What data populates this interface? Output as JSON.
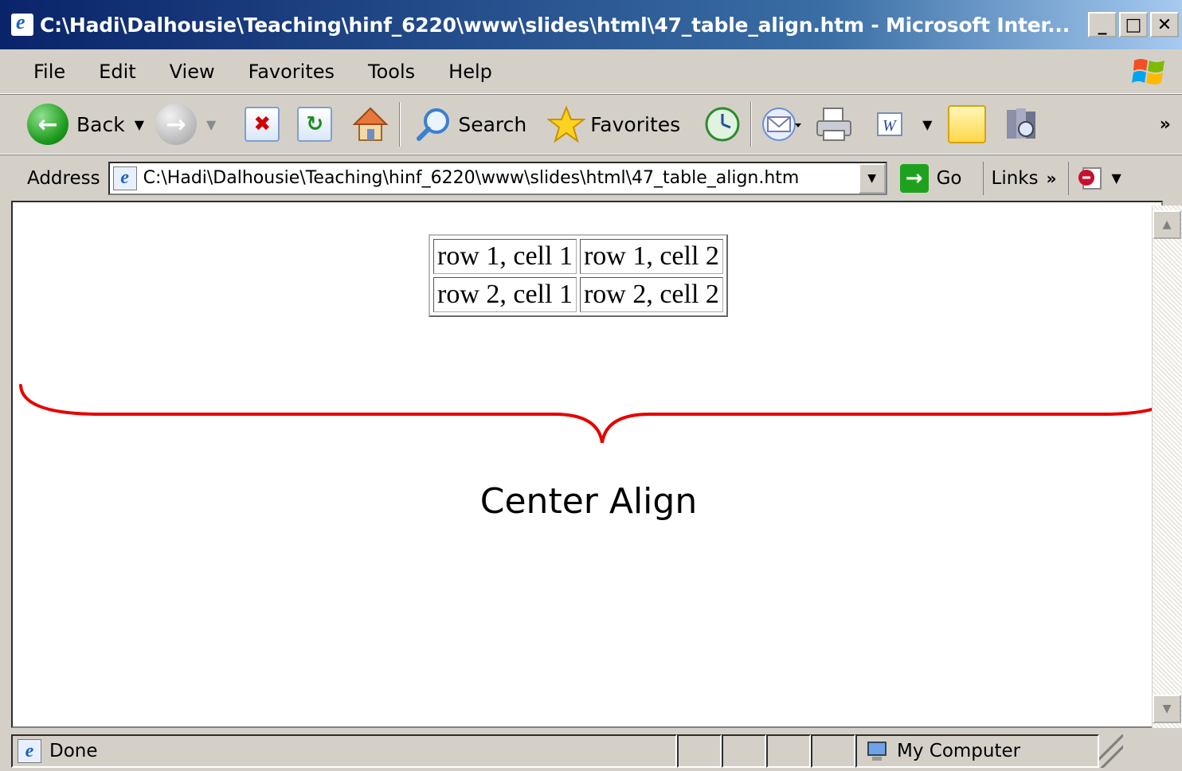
{
  "window": {
    "title": "C:\\Hadi\\Dalhousie\\Teaching\\hinf_6220\\www\\slides\\html\\47_table_align.htm - Microsoft Inter...",
    "controls": [
      "_",
      "□",
      "✕"
    ]
  },
  "menu": [
    "File",
    "Edit",
    "View",
    "Favorites",
    "Tools",
    "Help"
  ],
  "toolbar": {
    "back_label": "Back",
    "search_label": "Search",
    "favorites_label": "Favorites",
    "more": "»"
  },
  "address": {
    "label": "Address",
    "value": "C:\\Hadi\\Dalhousie\\Teaching\\hinf_6220\\www\\slides\\html\\47_table_align.htm",
    "go_label": "Go",
    "links_label": "Links",
    "links_more": "»"
  },
  "page": {
    "table": [
      [
        "row 1, cell 1",
        "row 1, cell 2"
      ],
      [
        "row 2, cell 1",
        "row 2, cell 2"
      ]
    ],
    "caption": "Center Align",
    "brace_color": "#e60000"
  },
  "status": {
    "text": "Done",
    "zone": "My Computer"
  }
}
